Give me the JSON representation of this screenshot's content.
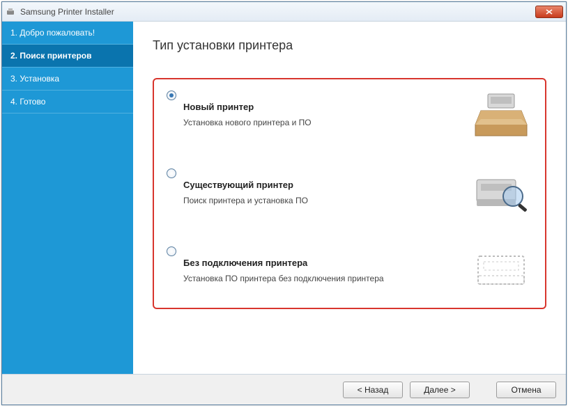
{
  "window": {
    "title": "Samsung Printer Installer"
  },
  "sidebar": {
    "steps": [
      {
        "label": "1. Добро пожаловать!"
      },
      {
        "label": "2. Поиск принтеров"
      },
      {
        "label": "3. Установка"
      },
      {
        "label": "4. Готово"
      }
    ],
    "active_index": 1
  },
  "main": {
    "title": "Тип установки принтера",
    "options": [
      {
        "title": "Новый принтер",
        "desc": "Установка нового принтера и ПО",
        "image": "printer-in-box",
        "selected": true
      },
      {
        "title": "Существующий принтер",
        "desc": "Поиск принтера и установка ПО",
        "image": "printer-magnify",
        "selected": false
      },
      {
        "title": "Без подключения принтера",
        "desc": "Установка ПО принтера без подключения принтера",
        "image": "printer-outline",
        "selected": false
      }
    ]
  },
  "footer": {
    "back": "< Назад",
    "next": "Далее >",
    "cancel": "Отмена"
  }
}
